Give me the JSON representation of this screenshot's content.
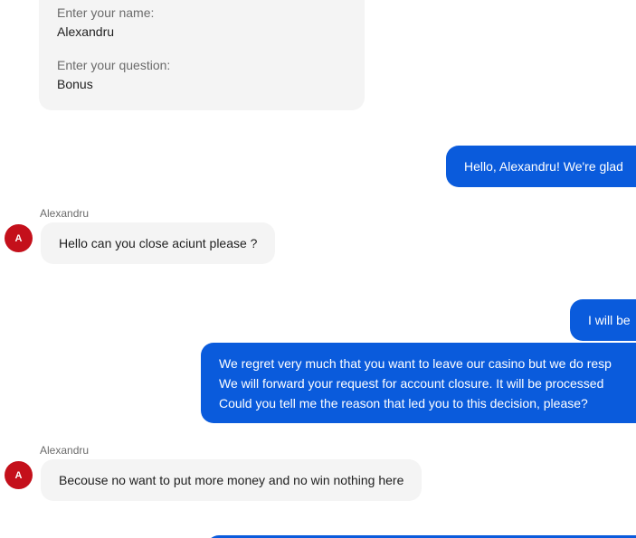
{
  "form": {
    "name_label": "Enter your name:",
    "name_value": "Alexandru",
    "question_label": "Enter your question:",
    "question_value": "Bonus"
  },
  "messages": {
    "agent_greeting": "Hello, Alexandru! We're glad",
    "agent_will_be": "I will be",
    "agent_regret_lines": [
      "We regret very much that you want to leave our casino but we do resp",
      "We will forward your request for account closure. It will be processed",
      "Could you tell me the reason that led you to this decision, please?"
    ],
    "customer": [
      {
        "name": "Alexandru",
        "avatar_initial": "A",
        "text": "Hello can you close aciunt please ?"
      },
      {
        "name": "Alexandru",
        "avatar_initial": "A",
        "text": "Becouse no want to put more money and no win nothing here"
      }
    ]
  },
  "colors": {
    "agent_bubble": "#0a5bdc",
    "customer_bubble": "#f4f4f4",
    "avatar": "#c4101b"
  }
}
